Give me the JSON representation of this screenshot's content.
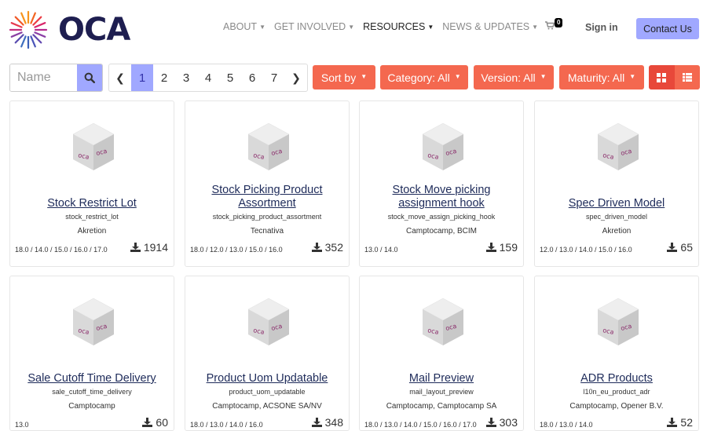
{
  "header": {
    "logo_text": "OCA",
    "nav": [
      {
        "label": "ABOUT",
        "caret": "▼",
        "active": false
      },
      {
        "label": "GET INVOLVED",
        "caret": "▼",
        "active": false
      },
      {
        "label": "RESOURCES",
        "caret": "▼",
        "active": true
      },
      {
        "label": "NEWS & UPDATES",
        "caret": "▼",
        "active": false
      }
    ],
    "cart_count": "0",
    "signin_label": "Sign in",
    "contact_label": "Contact Us"
  },
  "toolbar": {
    "search_placeholder": "Name",
    "pages": [
      "1",
      "2",
      "3",
      "4",
      "5",
      "6",
      "7"
    ],
    "current_page": "1",
    "prev_label": "❮",
    "next_label": "❯",
    "dropdowns": [
      {
        "label": "Sort by",
        "caret": "▼"
      },
      {
        "label": "Category: All",
        "caret": "▼"
      },
      {
        "label": "Version: All",
        "caret": "▼"
      },
      {
        "label": "Maturity: All",
        "caret": "▼"
      }
    ]
  },
  "cards": [
    {
      "title": "Stock Restrict Lot",
      "technical": "stock_restrict_lot",
      "author": "Akretion",
      "versions": "18.0 / 14.0 / 15.0 / 16.0 / 17.0",
      "downloads": "1914"
    },
    {
      "title": "Stock Picking Product Assortment",
      "technical": "stock_picking_product_assortment",
      "author": "Tecnativa",
      "versions": "18.0 / 12.0 / 13.0 / 15.0 / 16.0",
      "downloads": "352"
    },
    {
      "title": "Stock Move picking assignment hook",
      "technical": "stock_move_assign_picking_hook",
      "author": "Camptocamp, BCIM",
      "versions": "13.0 / 14.0",
      "downloads": "159"
    },
    {
      "title": "Spec Driven Model",
      "technical": "spec_driven_model",
      "author": "Akretion",
      "versions": "12.0 / 13.0 / 14.0 / 15.0 / 16.0",
      "downloads": "65"
    },
    {
      "title": "Sale Cutoff Time Delivery",
      "technical": "sale_cutoff_time_delivery",
      "author": "Camptocamp",
      "versions": "13.0",
      "downloads": "60"
    },
    {
      "title": "Product Uom Updatable",
      "technical": "product_uom_updatable",
      "author": "Camptocamp, ACSONE SA/NV",
      "versions": "18.0 / 13.0 / 14.0 / 16.0",
      "downloads": "348"
    },
    {
      "title": "Mail Preview",
      "technical": "mail_layout_preview",
      "author": "Camptocamp, Camptocamp SA",
      "versions": "18.0 / 13.0 / 14.0 / 15.0 / 16.0 / 17.0",
      "downloads": "303"
    },
    {
      "title": "ADR Products",
      "technical": "l10n_eu_product_adr",
      "author": "Camptocamp, Opener B.V.",
      "versions": "18.0 / 13.0 / 14.0",
      "downloads": "52"
    }
  ],
  "icons": {
    "search": "search-icon",
    "cart": "cart-icon",
    "download": "download-icon",
    "grid": "grid-view-icon",
    "list": "list-view-icon",
    "module": "module-cube-icon"
  },
  "colors": {
    "accent": "#a0a8ff",
    "dropdown": "#f4684f",
    "title": "#1e2b5a"
  }
}
